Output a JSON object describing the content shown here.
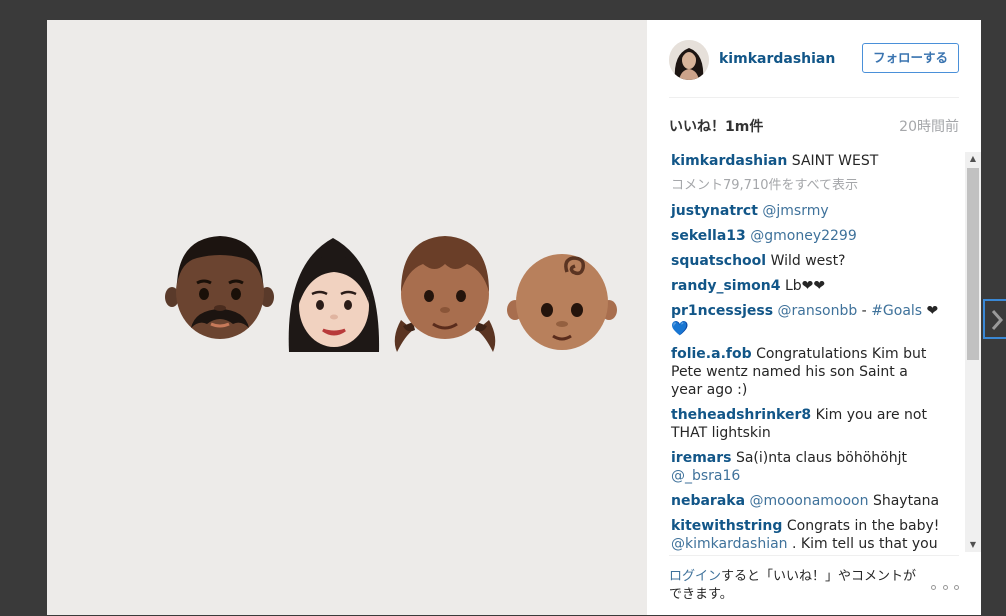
{
  "post": {
    "username": "kimkardashian",
    "follow_label": "フォローする",
    "likes": "いいね！1m件",
    "time_ago": "20時間前",
    "caption": {
      "user": "kimkardashian",
      "text": "SAINT WEST"
    },
    "view_all_comments": "コメント79,710件をすべて表示"
  },
  "comments": [
    {
      "user": "justynatrct",
      "parts": [
        {
          "type": "mention",
          "text": "@jmsrmy"
        }
      ]
    },
    {
      "user": "sekella13",
      "parts": [
        {
          "type": "mention",
          "text": "@gmoney2299"
        }
      ]
    },
    {
      "user": "squatschool",
      "parts": [
        {
          "type": "text",
          "text": "Wild west?"
        }
      ]
    },
    {
      "user": "randy_simon4",
      "parts": [
        {
          "type": "text",
          "text": "Lb❤❤"
        }
      ]
    },
    {
      "user": "pr1ncessjess",
      "parts": [
        {
          "type": "mention",
          "text": "@ransonbb"
        },
        {
          "type": "text",
          "text": " - "
        },
        {
          "type": "tag",
          "text": "#Goals"
        },
        {
          "type": "text",
          "text": " ❤💙"
        }
      ]
    },
    {
      "user": "folie.a.fob",
      "parts": [
        {
          "type": "text",
          "text": "Congratulations Kim but Pete wentz named his son Saint a year ago :)"
        }
      ]
    },
    {
      "user": "theheadshrinker8",
      "parts": [
        {
          "type": "text",
          "text": "Kim you are not THAT lightskin"
        }
      ]
    },
    {
      "user": "iremars",
      "parts": [
        {
          "type": "text",
          "text": "Sa(i)nta claus böhöhöhjt "
        },
        {
          "type": "mention",
          "text": "@_bsra16"
        }
      ]
    },
    {
      "user": "nebaraka",
      "parts": [
        {
          "type": "mention",
          "text": "@mooonamooon"
        },
        {
          "type": "text",
          "text": " Shaytana"
        }
      ]
    },
    {
      "user": "kitewithstring",
      "parts": [
        {
          "type": "text",
          "text": "Congrats in the baby! "
        },
        {
          "type": "mention",
          "text": "@kimkardashian"
        },
        {
          "type": "text",
          "text": " . Kim tell us that you will show some behind the scene action of your selfie wax figure in London!!!"
        }
      ]
    }
  ],
  "footer": {
    "login_link": "ログイン",
    "text": "すると「いいね！」やコメントができます。"
  },
  "colors": {
    "link": "#125688",
    "mention": "#3f729b",
    "muted": "#a5a7aa",
    "follow_border": "#4a90d9",
    "overlay": "#3a3a3a",
    "media_bg": "#edebe9"
  },
  "icons": {
    "more": "more-options-icon",
    "scroll_up": "scroll-up-arrow-icon",
    "scroll_down": "scroll-down-arrow-icon",
    "next": "chevron-right-icon"
  }
}
